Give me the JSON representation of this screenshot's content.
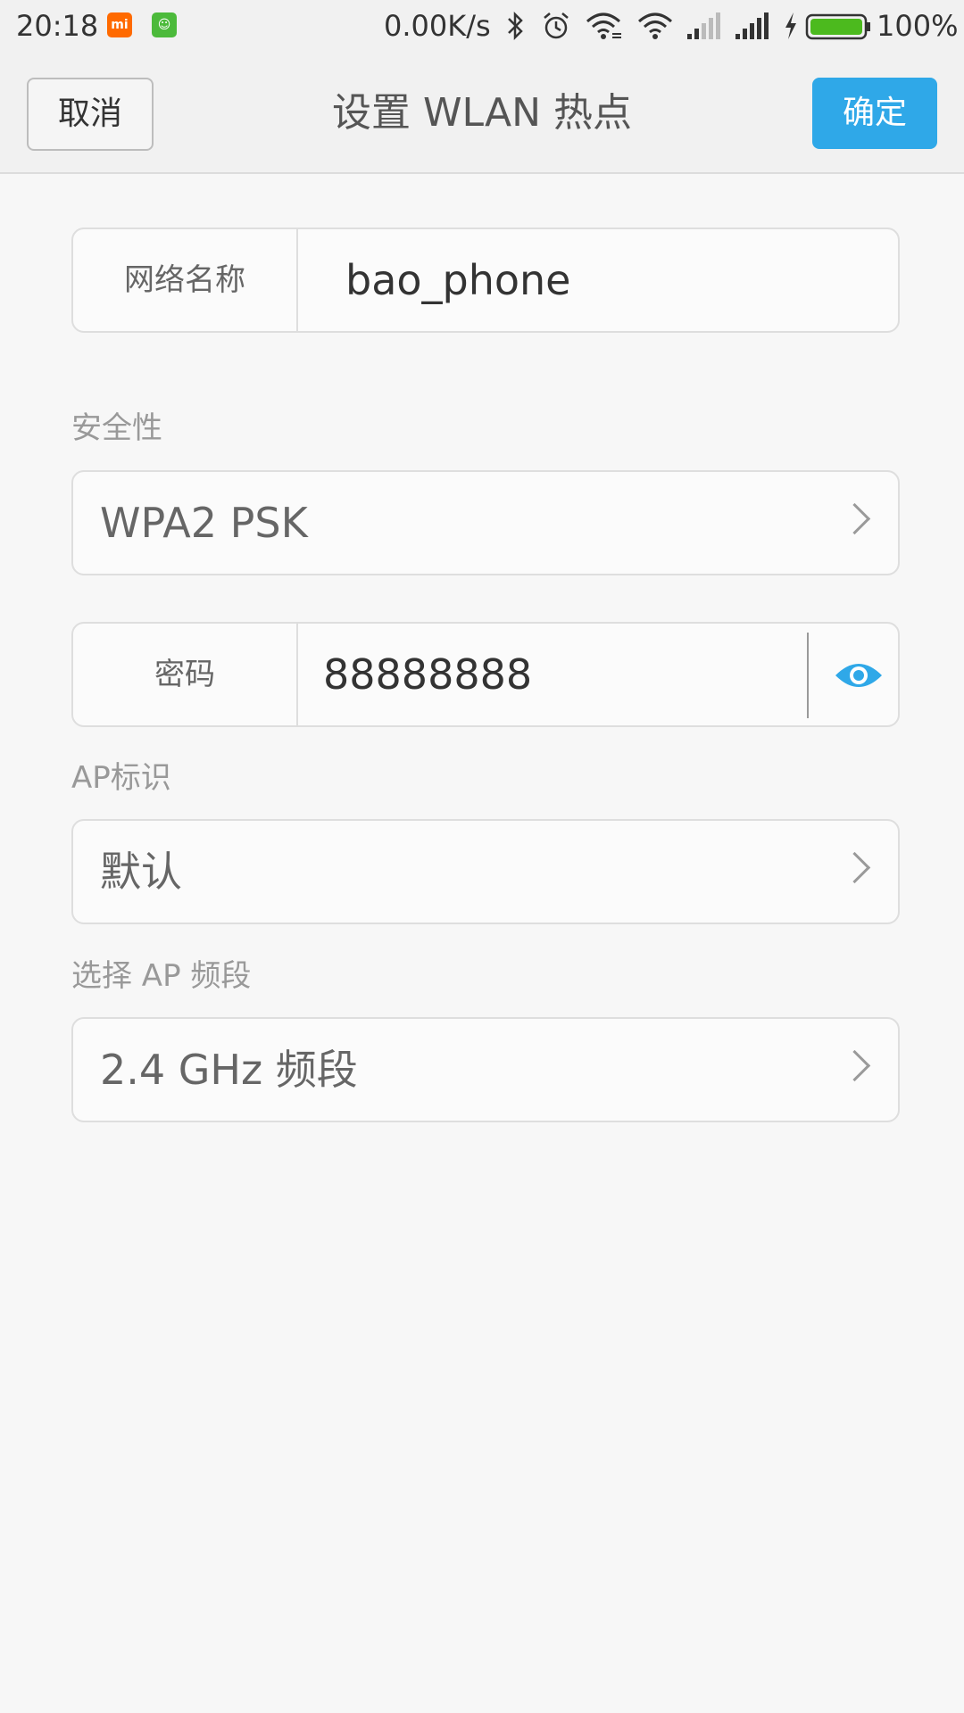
{
  "status_bar": {
    "time": "20:18",
    "network_speed": "0.00K/s",
    "battery": "100%",
    "icons": [
      "mi-app-icon",
      "cat-app-icon",
      "bluetooth-icon",
      "alarm-icon",
      "wifi-link-icon",
      "wifi-icon",
      "signal-1-icon",
      "signal-2-icon",
      "charging-icon",
      "battery-icon"
    ],
    "battery_color": "#4cba1e"
  },
  "header": {
    "cancel_label": "取消",
    "title": "设置  WLAN  热点",
    "confirm_label": "确定",
    "accent_color": "#2fa8e8"
  },
  "form": {
    "network_name": {
      "label": "网络名称",
      "value": "bao_phone"
    },
    "security": {
      "section_label": "安全性",
      "value": "WPA2 PSK"
    },
    "password": {
      "label": "密码",
      "value": "88888888"
    },
    "ap_id": {
      "section_label": "AP标识",
      "value": "默认"
    },
    "ap_band": {
      "section_label": "选择 AP 频段",
      "value": "2.4 GHz 频段"
    }
  }
}
